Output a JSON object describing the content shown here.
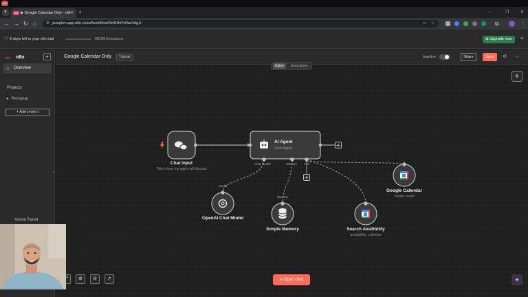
{
  "os": {
    "logo_text": "n8n"
  },
  "browser": {
    "tab_title": "Google Calendar Only - n8n",
    "tab_favicon_text": "n8n",
    "url": "josephm.app.n8n.cloud/workflow/RzADhiYvDarSAgJr",
    "icons": [
      "search-icon",
      "back-icon",
      "forward-icon",
      "reload-icon",
      "home-icon",
      "site-info-icon",
      "bookmark-icon",
      "extensions-icon",
      "profile-icon",
      "menu-icon"
    ]
  },
  "banner": {
    "trial_text": "3 days left in your n8n trial",
    "executions_text": "0/1000 Executions",
    "executions_used_fraction": 0.0,
    "upgrade_label": "Upgrade now"
  },
  "sidebar": {
    "logo_text": "n8n",
    "overview_label": "Overview",
    "projects_heading": "Projects",
    "personal_label": "Personal",
    "add_project_label": "+ Add project",
    "admin_panel_label": "Admin Panel"
  },
  "workflow": {
    "title": "Google Calendar Only",
    "tag": "Tutorial",
    "inactive_label": "Inactive",
    "share_label": "Share",
    "save_label": "Save",
    "tabs": {
      "editor": "Editor",
      "executions": "Executions"
    }
  },
  "nodes": {
    "chat_input": {
      "label": "Chat Input",
      "subtitle": "This is how my agent will discuss"
    },
    "ai_agent": {
      "label": "AI Agent",
      "subtitle": "Tools Agent",
      "ports": {
        "chat_model": "Chat Model*",
        "memory": "Memory",
        "tool": "Tool"
      }
    },
    "openai_model": {
      "label": "OpenAI Chat Model",
      "port_label": "Model"
    },
    "simple_memory": {
      "label": "Simple Memory",
      "port_label": "Memory"
    },
    "search_availability": {
      "label": "Search Availibility",
      "subtitle": "availability: calendar"
    },
    "google_calendar": {
      "label": "Google Calendar",
      "subtitle": "create: event"
    }
  },
  "canvas": {
    "open_chat_label": "Open chat",
    "zoom_controls": [
      "fit-view-icon",
      "zoom-in-icon",
      "zoom-out-icon",
      "pointer-icon"
    ]
  },
  "colors": {
    "accent": "#ff6d5a",
    "upgrade": "#2e7d4f",
    "brand": "#ea4b71",
    "canvas_bg": "#1f1f1f"
  }
}
